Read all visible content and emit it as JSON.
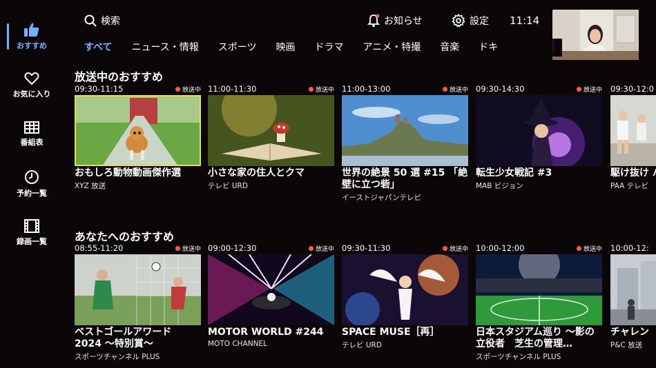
{
  "sidebar": {
    "items": [
      {
        "label": "おすすめ",
        "icon": "thumbs-up-icon",
        "active": true
      },
      {
        "label": "お気に入り",
        "icon": "heart-icon",
        "active": false
      },
      {
        "label": "番組表",
        "icon": "program-guide-icon",
        "active": false
      },
      {
        "label": "予約一覧",
        "icon": "clock-icon",
        "active": false
      },
      {
        "label": "録画一覧",
        "icon": "film-icon",
        "active": false
      }
    ]
  },
  "header": {
    "search_label": "検索",
    "notice_label": "お知らせ",
    "settings_label": "設定",
    "time": "11:14",
    "tabs": [
      "すべて",
      "ニュース・情報",
      "スポーツ",
      "映画",
      "ドラマ",
      "アニメ・特撮",
      "音楽",
      "ドキ"
    ]
  },
  "sections": [
    {
      "title": "放送中のおすすめ",
      "cards": [
        {
          "time": "09:30-11:15",
          "live": "放送中",
          "title": "おもしろ動物動画傑作選",
          "channel": "XYZ 放送"
        },
        {
          "time": "11:00-11:30",
          "live": "放送中",
          "title": "小さな家の住人とクマ",
          "channel": "テレビ URD"
        },
        {
          "time": "11:00-13:00",
          "live": "放送中",
          "title": "世界の絶景 50 選 #15 「絶壁に立つ砦」",
          "channel": "イーストジャパンテレビ"
        },
        {
          "time": "09:30-14:30",
          "live": "放送中",
          "title": "転生少女戦記 #3",
          "channel": "MAB ビジョン"
        },
        {
          "time": "09:30-12:0",
          "live": "",
          "title": "駆け抜け バトン！",
          "channel": "PAA テレビ"
        }
      ]
    },
    {
      "title": "あなたへのおすすめ",
      "cards": [
        {
          "time": "08:55-11:20",
          "live": "放送中",
          "title": "ベストゴールアワード 2024 〜特別賞〜",
          "channel": "スポーツチャンネル PLUS"
        },
        {
          "time": "09:00-12:30",
          "live": "放送中",
          "title": "MOTOR WORLD #244",
          "channel": "MOTO CHANNEL"
        },
        {
          "time": "09:30-11:30",
          "live": "放送中",
          "title": "SPACE MUSE［再］",
          "channel": "テレビ URD"
        },
        {
          "time": "10:00-12:00",
          "live": "放送中",
          "title": "日本スタジアム巡り 〜影の立役者　芝生の管理…",
          "channel": "スポーツチャンネル PLUS"
        },
        {
          "time": "10:00-12:",
          "live": "",
          "title": "チャレン",
          "channel": "P&C 放送"
        }
      ]
    }
  ],
  "colors": {
    "accent": "#6fb4ff",
    "live_dot": "#ff5a3c",
    "focus": "#e8e046",
    "background": "#0b0608"
  }
}
